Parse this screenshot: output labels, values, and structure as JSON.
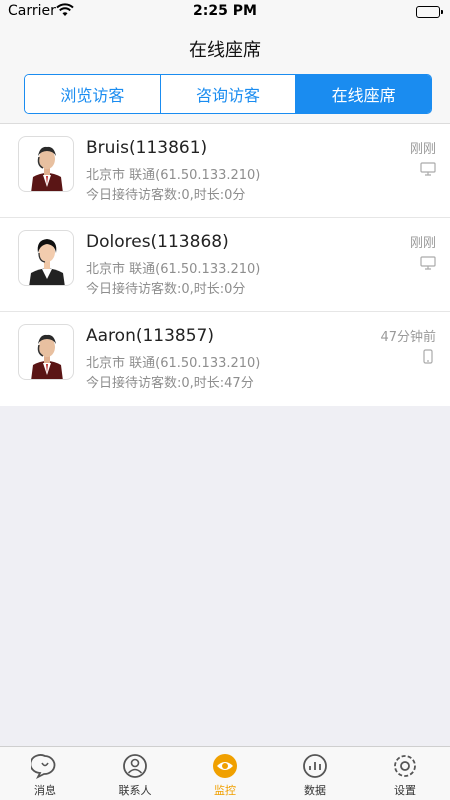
{
  "status": {
    "carrier": "Carrier",
    "time": "2:25 PM"
  },
  "nav": {
    "title": "在线座席"
  },
  "segments": [
    {
      "label": "浏览访客",
      "active": false
    },
    {
      "label": "咨询访客",
      "active": false
    },
    {
      "label": "在线座席",
      "active": true
    }
  ],
  "agents": [
    {
      "name": "Bruis(113861)",
      "location": "北京市 联通(61.50.133.210)",
      "stats": "今日接待访客数:0,时长:0分",
      "time": "刚刚",
      "device": "desktop-icon"
    },
    {
      "name": "Dolores(113868)",
      "location": "北京市 联通(61.50.133.210)",
      "stats": "今日接待访客数:0,时长:0分",
      "time": "刚刚",
      "device": "desktop-icon"
    },
    {
      "name": "Aaron(113857)",
      "location": "北京市 联通(61.50.133.210)",
      "stats": "今日接待访客数:0,时长:47分",
      "time": "47分钟前",
      "device": "mobile-icon"
    }
  ],
  "tabbar": [
    {
      "label": "消息",
      "icon": "chat-bubble-icon",
      "active": false
    },
    {
      "label": "联系人",
      "icon": "contacts-icon",
      "active": false
    },
    {
      "label": "监控",
      "icon": "monitor-eye-icon",
      "active": true
    },
    {
      "label": "数据",
      "icon": "data-icon",
      "active": false
    },
    {
      "label": "设置",
      "icon": "settings-icon",
      "active": false
    }
  ],
  "colors": {
    "accent": "#1a8cf0",
    "tab_active": "#f0a000"
  }
}
